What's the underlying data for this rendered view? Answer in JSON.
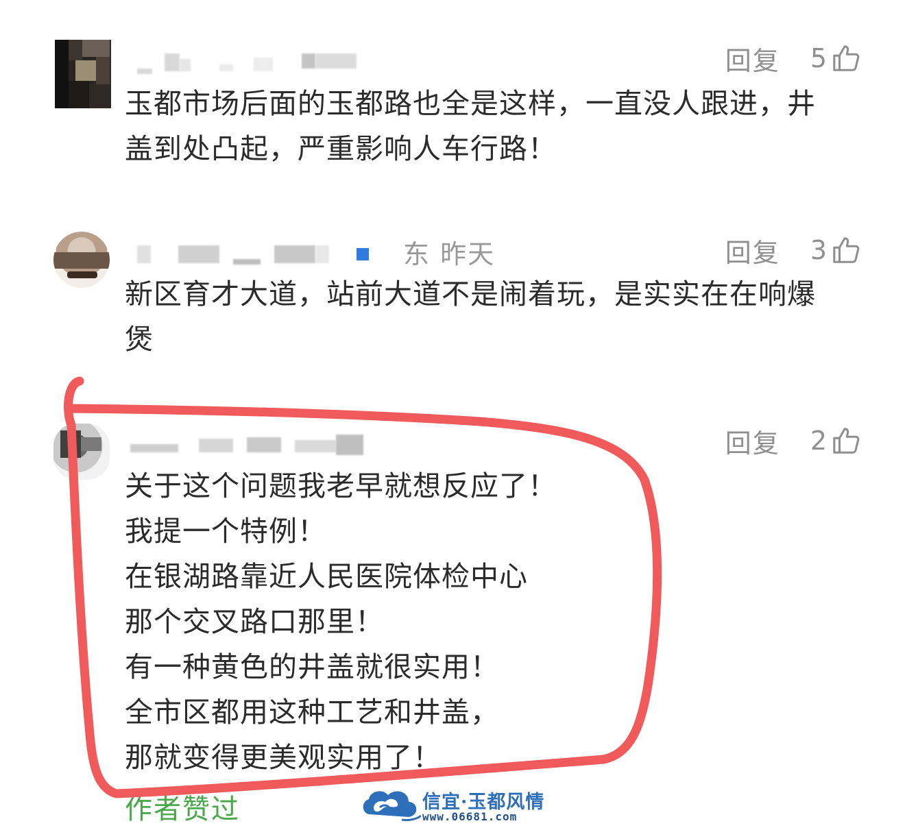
{
  "comments": [
    {
      "name_time": "",
      "reply_label": "回复",
      "likes": "5",
      "lines": [
        "玉都市场后面的玉都路也全是这样，一直没人跟进，井",
        "盖到处凸起，严重影响人车行路！"
      ]
    },
    {
      "name_time": "东 昨天",
      "reply_label": "回复",
      "likes": "3",
      "lines": [
        "新区育才大道，站前大道不是闹着玩，是实实在在响爆",
        "煲"
      ]
    },
    {
      "name_time": "",
      "reply_label": "回复",
      "likes": "2",
      "lines": [
        "关于这个问题我老早就想反应了！",
        "我提一个特例！",
        "在银湖路靠近人民医院体检中心",
        "那个交叉路口那里！",
        "有一种黄色的井盖就很实用！",
        "全市区都用这种工艺和井盖，",
        "那就变得更美观实用了！"
      ],
      "author_liked": "作者赞过"
    }
  ],
  "watermark": {
    "title": "信宜·玉都风情",
    "url": "www.06681.com"
  },
  "colors": {
    "text": "#2b2b2b",
    "meta": "#999999",
    "author_liked": "#4aa84a",
    "annotation": "#f05a5a",
    "watermark": "#2d6fb8"
  },
  "icons": {
    "like": "thumbs-up-icon"
  }
}
